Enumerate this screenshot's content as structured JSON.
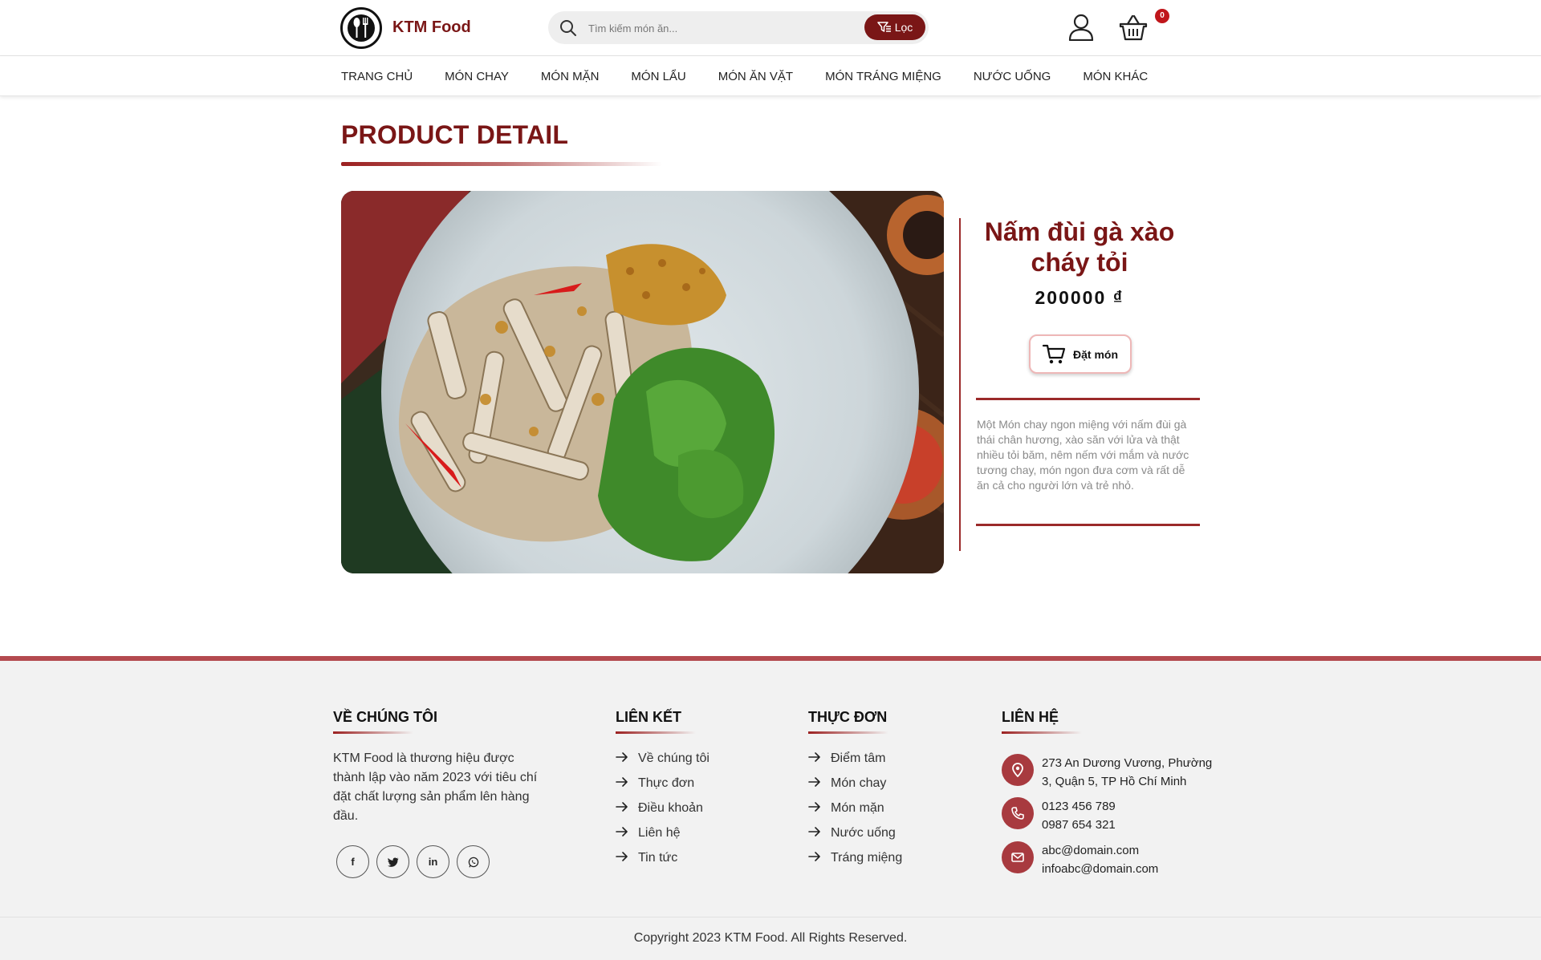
{
  "header": {
    "brand": "KTM Food",
    "search_placeholder": "Tìm kiếm món ăn...",
    "filter_label": "Lọc",
    "cart_count": "0"
  },
  "nav": [
    "TRANG CHỦ",
    "MÓN CHAY",
    "MÓN MẶN",
    "MÓN LẨU",
    "MÓN ĂN VẶT",
    "MÓN TRÁNG MIỆNG",
    "NƯỚC UỐNG",
    "MÓN KHÁC"
  ],
  "main": {
    "page_title": "PRODUCT DETAIL",
    "product": {
      "name": "Nấm đùi gà xào cháy tỏi",
      "price": "200000 ₫",
      "order_label": "Đặt món",
      "description": "Một Món chay ngon miệng với nấm đùi gà thái chân hương, xào săn với lửa và thật nhiều tỏi băm, nêm nếm với mắm và nước tương chay, món ngon đưa cơm và rất dễ ăn cả cho người lớn và trẻ nhỏ."
    }
  },
  "footer": {
    "about": {
      "heading": "VỀ CHÚNG TÔI",
      "text": "KTM Food là thương hiệu được thành lập vào năm 2023 với tiêu chí đặt chất lượng sản phẩm lên hàng đầu.",
      "socials": [
        "f",
        "twitter",
        "in",
        "whatsapp"
      ]
    },
    "links": {
      "heading": "LIÊN KẾT",
      "items": [
        "Về chúng tôi",
        "Thực đơn",
        "Điều khoản",
        "Liên hệ",
        "Tin tức"
      ]
    },
    "menu": {
      "heading": "THỰC ĐƠN",
      "items": [
        "Điểm tâm",
        "Món chay",
        "Món mặn",
        "Nước uống",
        "Tráng miệng"
      ]
    },
    "contact": {
      "heading": "LIÊN HỆ",
      "address_1": "273 An Dương Vương, Phường",
      "address_2": "3, Quận 5, TP Hồ Chí Minh",
      "phone_1": "0123 456 789",
      "phone_2": "0987 654 321",
      "email_1": "abc@domain.com",
      "email_2": "infoabc@domain.com"
    },
    "copyright": "Copyright 2023 KTM Food. All Rights Reserved."
  },
  "colors": {
    "brand": "#7a1616",
    "accent": "#a83a3f",
    "badge": "#c0161b"
  }
}
